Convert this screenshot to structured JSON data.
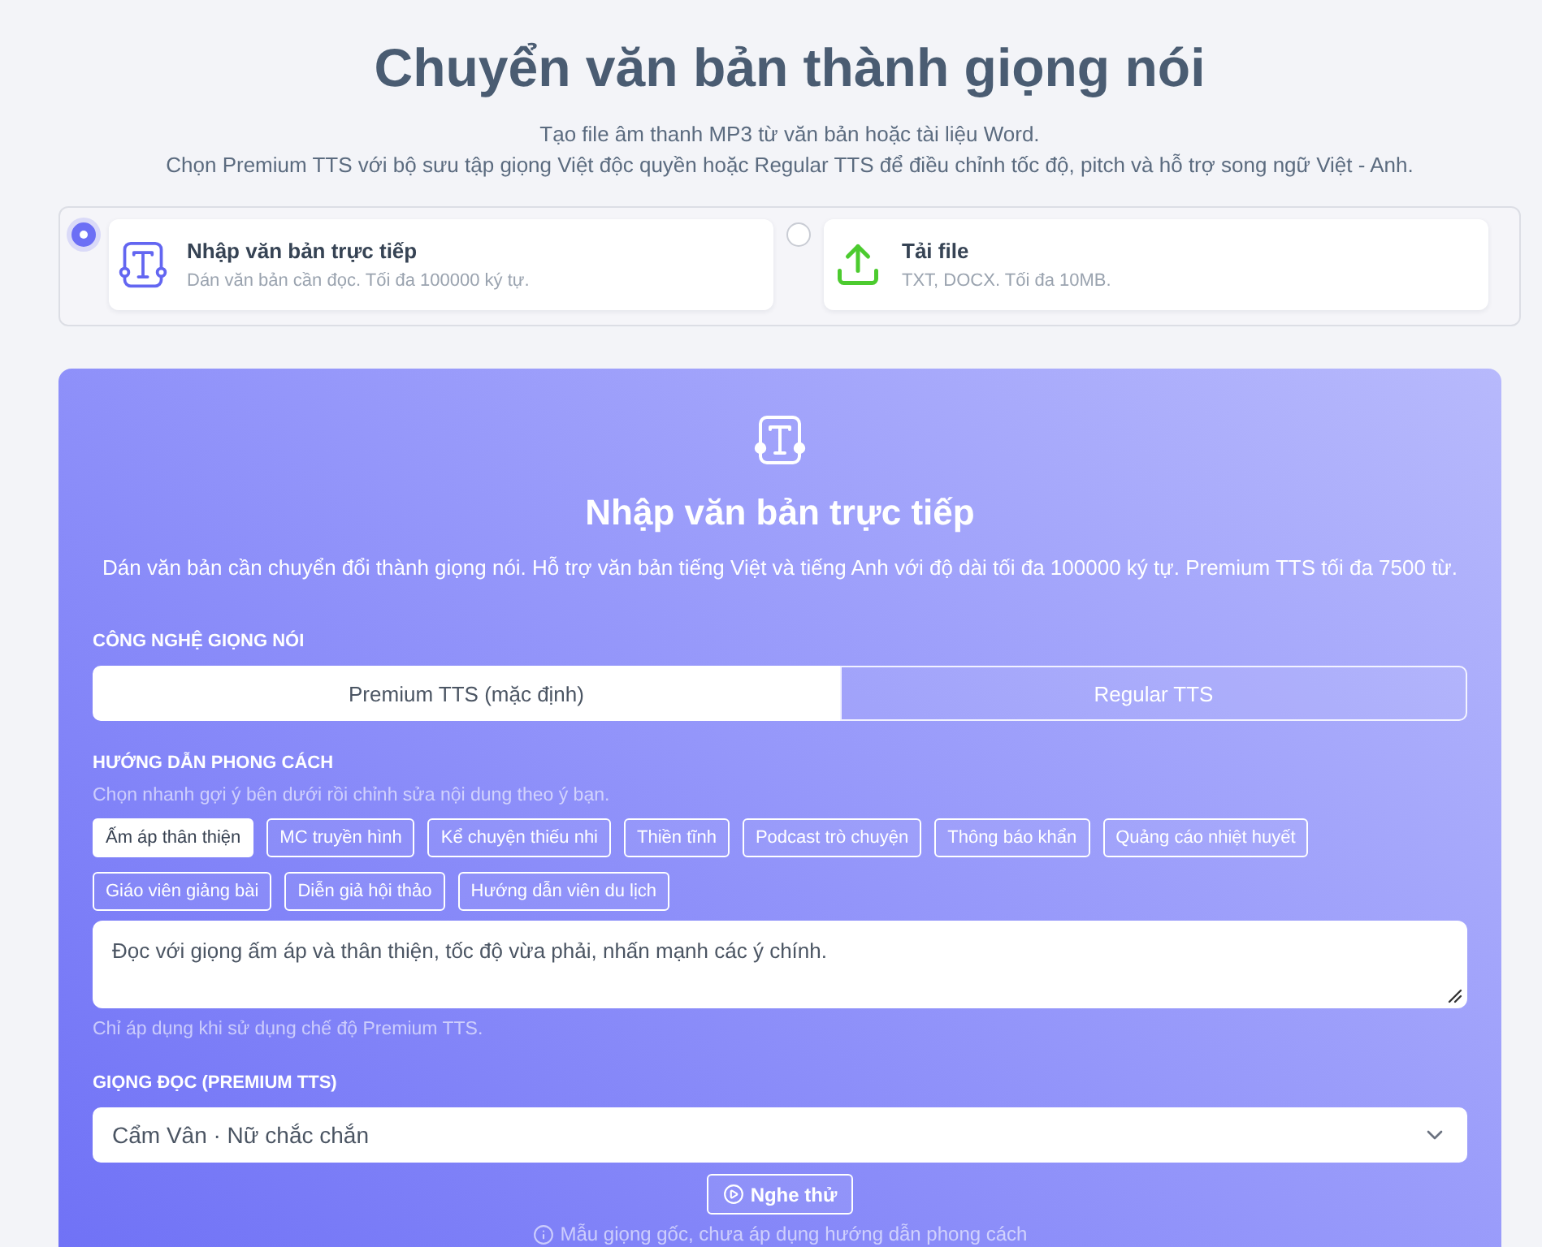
{
  "header": {
    "title": "Chuyển văn bản thành giọng nói",
    "subtitle_lines": [
      "Tạo file âm thanh MP3 từ văn bản hoặc tài liệu Word.",
      "Chọn Premium TTS với bộ sưu tập giọng Việt độc quyền hoặc Regular TTS để điều chỉnh tốc độ, pitch và hỗ trợ song ngữ Việt - Anh."
    ]
  },
  "input_modes": [
    {
      "kind": "text",
      "title": "Nhập văn bản trực tiếp",
      "description": "Dán văn bản cần đọc. Tối đa 100000 ký tự.",
      "selected": true
    },
    {
      "kind": "upload",
      "title": "Tải file",
      "description": "TXT, DOCX. Tối đa 10MB.",
      "selected": false
    }
  ],
  "panel": {
    "title": "Nhập văn bản trực tiếp",
    "description": "Dán văn bản cần chuyển đổi thành giọng nói. Hỗ trợ văn bản tiếng Việt và tiếng Anh với độ dài tối đa 100000 ký tự. Premium TTS tối đa 7500 từ.",
    "voice_technology": {
      "label": "CÔNG NGHỆ GIỌNG NÓI",
      "options": [
        {
          "label": "Premium TTS (mặc định)",
          "selected": true
        },
        {
          "label": "Regular TTS",
          "selected": false
        }
      ]
    },
    "style_guide": {
      "label": "HƯỚNG DẪN PHONG CÁCH",
      "hint": "Chọn nhanh gợi ý bên dưới rồi chỉnh sửa nội dung theo ý bạn.",
      "presets": [
        {
          "label": "Ấm áp thân thiện",
          "selected": true
        },
        {
          "label": "MC truyền hình",
          "selected": false
        },
        {
          "label": "Kể chuyện thiếu nhi",
          "selected": false
        },
        {
          "label": "Thiền tĩnh",
          "selected": false
        },
        {
          "label": "Podcast trò chuyện",
          "selected": false
        },
        {
          "label": "Thông báo khẩn",
          "selected": false
        },
        {
          "label": "Quảng cáo nhiệt huyết",
          "selected": false
        },
        {
          "label": "Giáo viên giảng bài",
          "selected": false
        },
        {
          "label": "Diễn giả hội thảo",
          "selected": false
        },
        {
          "label": "Hướng dẫn viên du lịch",
          "selected": false
        }
      ],
      "value": "Đọc với giọng ấm áp và thân thiện, tốc độ vừa phải, nhấn mạnh các ý chính.",
      "note": "Chỉ áp dụng khi sử dụng chế độ Premium TTS."
    },
    "voice": {
      "label": "GIỌNG ĐỌC (PREMIUM TTS)",
      "value": "Cẩm Vân · Nữ chắc chắn"
    },
    "preview_button": "Nghe thử",
    "preview_note": "Mẫu giọng gốc, chưa áp dụng hướng dẫn phong cách"
  }
}
